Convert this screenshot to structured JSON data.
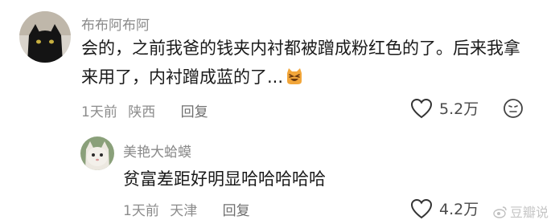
{
  "comments": [
    {
      "username": "布布阿布阿",
      "text": "会的，之前我爸的钱夹内衬都被蹭成粉红色的了。后来我拿来用了，内衬蹭成蓝的了...",
      "time": "1天前",
      "location": "陕西",
      "reply_label": "回复",
      "likes": "5.2万",
      "avatar_icon": "black-cat-avatar",
      "inline_emoji": "laughing-cat-emoji"
    },
    {
      "username": "美艳大蛤蟆",
      "text": "贫富差距好明显哈哈哈哈哈",
      "time": "1天前",
      "location": "天津",
      "reply_label": "回复",
      "likes": "4.2万",
      "avatar_icon": "white-cat-avatar"
    }
  ],
  "watermark": "豆瓣说"
}
